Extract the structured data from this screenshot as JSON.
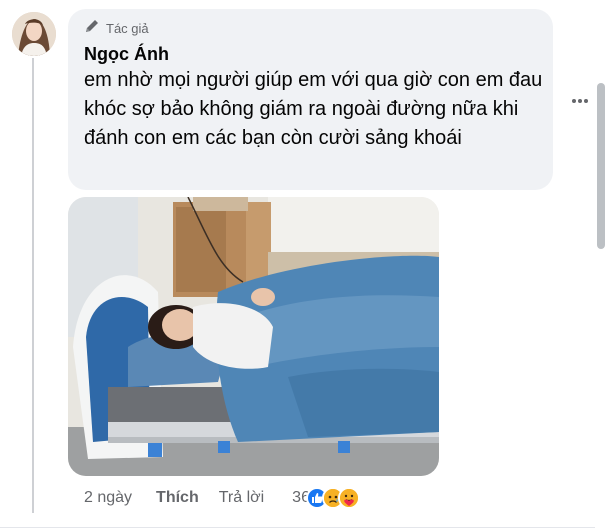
{
  "comment": {
    "role_label": "Tác giả",
    "author": "Ngọc Ánh",
    "text": "em nhờ mọi người giúp em với qua giờ con em đau khóc sợ bảo không giám ra ngoài đường nữa khi đánh con em các bạn còn cười sảng khoái",
    "time": "2 ngày",
    "like_label": "Thích",
    "reply_label": "Trả lời",
    "reaction_count": "36",
    "reactions": [
      "like-icon",
      "sad-icon",
      "care-icon"
    ],
    "more_icon": "more-horizontal-icon",
    "role_icon": "pen-icon",
    "photo_icon": "photo-attachment"
  },
  "colors": {
    "bubble_bg": "#f0f2f5",
    "text_primary": "#050505",
    "text_secondary": "#65676b",
    "like_blue": "#1877f2",
    "reaction_yellow": "#f7b125"
  }
}
